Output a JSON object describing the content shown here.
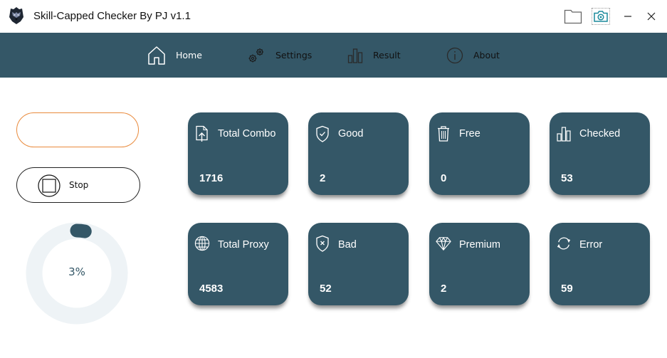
{
  "window": {
    "title": "Skill-Capped Checker By PJ v1.1",
    "logo_icon": "wolf-logo-icon",
    "buttons": {
      "folder_icon": "folder-icon",
      "camera_icon": "camera-icon",
      "minimize_icon": "minimize-icon",
      "close_icon": "close-icon"
    }
  },
  "nav": {
    "items": [
      {
        "label": "Home",
        "icon": "home-icon",
        "active": true
      },
      {
        "label": "Settings",
        "icon": "gears-icon",
        "active": false
      },
      {
        "label": "Result",
        "icon": "bar-chart-icon",
        "active": false
      },
      {
        "label": "About",
        "icon": "info-icon",
        "active": false
      }
    ]
  },
  "controls": {
    "combo_input_value": "",
    "stop_label": "Stop",
    "progress_percent": 3,
    "progress_text": "3%"
  },
  "colors": {
    "primary": "#345767",
    "accent_orange": "#e98a3c",
    "ring_track": "#eef3f6",
    "camera_teal": "#1b8a9c"
  },
  "stats": {
    "total_combo": {
      "label": "Total Combo",
      "value": "1716",
      "icon": "file-upload-icon"
    },
    "good": {
      "label": "Good",
      "value": "2",
      "icon": "shield-check-icon"
    },
    "free": {
      "label": "Free",
      "value": "0",
      "icon": "trash-icon"
    },
    "checked": {
      "label": "Checked",
      "value": "53",
      "icon": "bar-chart-icon"
    },
    "total_proxy": {
      "label": "Total Proxy",
      "value": "4583",
      "icon": "globe-icon"
    },
    "bad": {
      "label": "Bad",
      "value": "52",
      "icon": "shield-x-icon"
    },
    "premium": {
      "label": "Premium",
      "value": "2",
      "icon": "diamond-icon"
    },
    "error": {
      "label": "Error",
      "value": "59",
      "icon": "refresh-icon"
    }
  }
}
